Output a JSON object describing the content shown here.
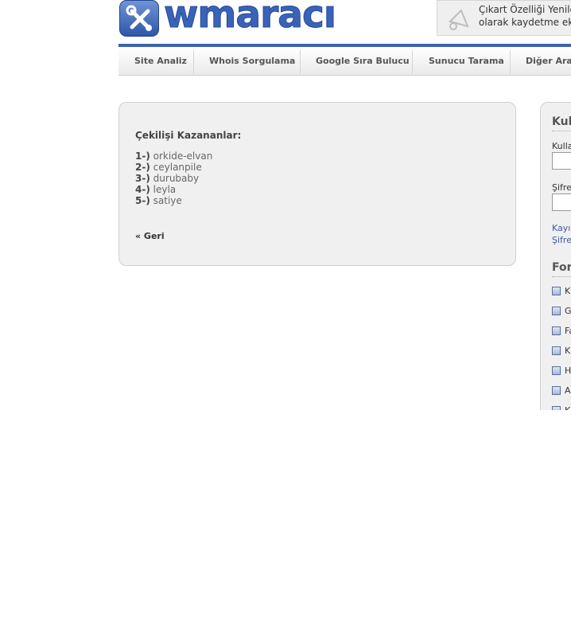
{
  "header": {
    "logo_text": "wmaracı",
    "notice_line1": "Çıkart Özelliği Yenile",
    "notice_line2": "olarak kaydetme ek"
  },
  "nav": {
    "items": [
      {
        "label": "Site Analiz"
      },
      {
        "label": "Whois Sorgulama"
      },
      {
        "label": "Google Sıra Bulucu"
      },
      {
        "label": "Sunucu Tarama"
      },
      {
        "label": "Diğer Araç"
      }
    ]
  },
  "main": {
    "heading": "Çekilişi Kazananlar:",
    "winners": [
      {
        "num": "1-)",
        "name": "orkide-elvan"
      },
      {
        "num": "2-)",
        "name": "ceylanpile"
      },
      {
        "num": "3-)",
        "name": "durubaby"
      },
      {
        "num": "4-)",
        "name": "leyla"
      },
      {
        "num": "5-)",
        "name": "satiye"
      }
    ],
    "back_link": "« Geri"
  },
  "sidebar": {
    "login_heading": "Kul",
    "username_label": "Kulla",
    "password_label": "Şifre",
    "link_register": "Kayı",
    "link_forgot": "Şifre",
    "forum_heading": "For",
    "forum_items": [
      "K",
      "G",
      "Fa",
      "K",
      "H",
      "A",
      "K"
    ]
  },
  "colors": {
    "brand_blue": "#3d62b0",
    "panel_bg": "#f0f0f0",
    "link": "#3a5aa8"
  }
}
